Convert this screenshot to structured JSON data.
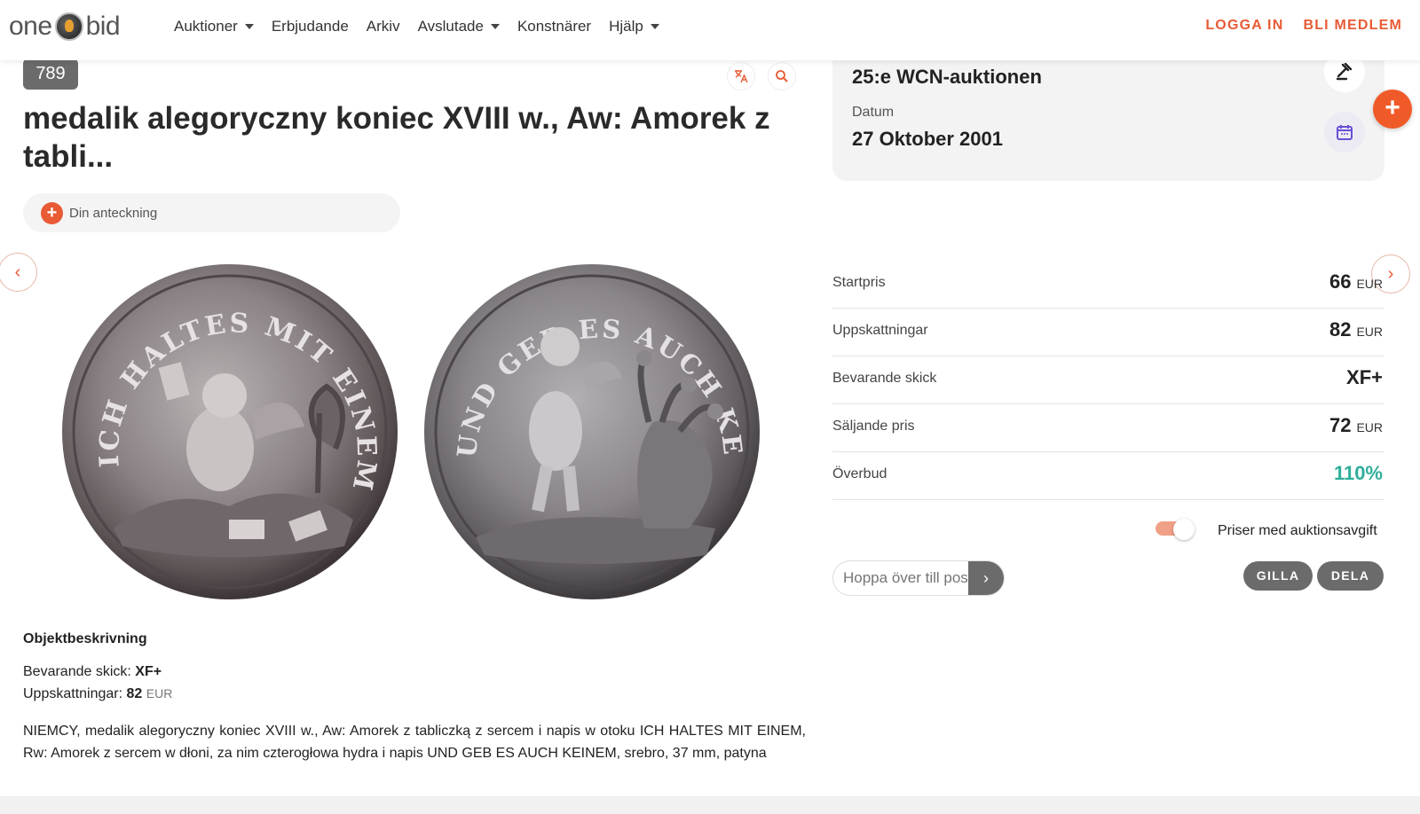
{
  "nav": {
    "logo_left": "one",
    "logo_right": "bid",
    "menu": [
      {
        "label": "Auktioner",
        "dropdown": true
      },
      {
        "label": "Erbjudande",
        "dropdown": false
      },
      {
        "label": "Arkiv",
        "dropdown": false
      },
      {
        "label": "Avslutade",
        "dropdown": true
      },
      {
        "label": "Konstnärer",
        "dropdown": false
      },
      {
        "label": "Hjälp",
        "dropdown": true
      }
    ],
    "login": "LOGGA IN",
    "register": "BLI MEDLEM"
  },
  "lot": {
    "number": "789",
    "title": "medalik alegoryczny koniec XVIII w., Aw: Amorek z tabli...",
    "note_label": "Din anteckning",
    "icons": {
      "translate": "translate-icon",
      "zoom": "search-icon"
    }
  },
  "coins": {
    "obverse_legend": "ICH HALTES MIT EINEM",
    "reverse_legend": "UND GEB ES AUCH KEINEM"
  },
  "description": {
    "heading": "Objektbeskrivning",
    "condition_label": "Bevarande skick:",
    "condition_value": "XF+",
    "estimate_label": "Uppskattningar:",
    "estimate_value": "82",
    "estimate_currency": "EUR",
    "text": "NIEMCY, medalik alegoryczny koniec XVIII w., Aw: Amorek z tabliczką z sercem i napis w otoku ICH HALTES MIT EINEM, Rw: Amorek z sercem w dłoni, za nim czterogłowa hydra i napis UND GEB ES AUCH KEINEM, srebro, 37 mm, patyna"
  },
  "auction": {
    "name": "25:e WCN-auktionen",
    "date_label": "Datum",
    "date_value": "27 Oktober 2001"
  },
  "prices": [
    {
      "label": "Startpris",
      "value": "66",
      "currency": "EUR"
    },
    {
      "label": "Uppskattningar",
      "value": "82",
      "currency": "EUR"
    },
    {
      "label": "Bevarande skick",
      "value": "XF+",
      "currency": ""
    },
    {
      "label": "Säljande pris",
      "value": "72",
      "currency": "EUR"
    },
    {
      "label": "Överbud",
      "value": "110%",
      "currency": ""
    }
  ],
  "toggle": {
    "label": "Priser med auktionsavgift",
    "on": true
  },
  "jump": {
    "placeholder": "Hoppa över till posten"
  },
  "actions": {
    "like": "GILLA",
    "share": "DELA"
  },
  "colors": {
    "accent": "#e85b35",
    "green": "#2fae9b",
    "badge": "#6b6b6b"
  }
}
